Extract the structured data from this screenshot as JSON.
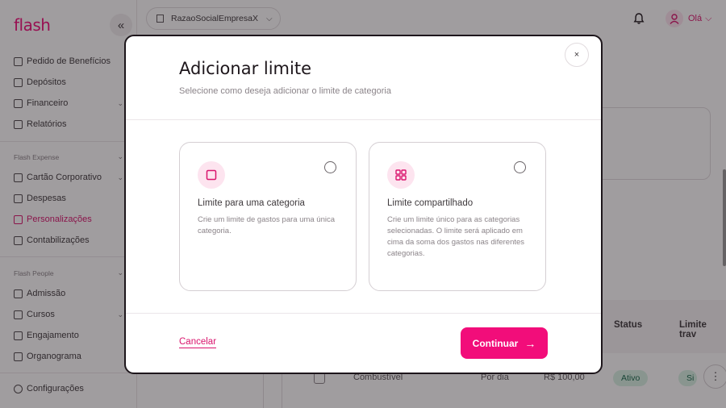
{
  "brand": {
    "logo": "flash",
    "accent": "#f20d7a"
  },
  "sidebar": {
    "collapse_icon": "«",
    "items": [
      {
        "label": "Pedido de Benefícios",
        "icon": "cart-icon"
      },
      {
        "label": "Depósitos",
        "icon": "receipt-icon"
      },
      {
        "label": "Financeiro",
        "icon": "bank-icon"
      },
      {
        "label": "Relatórios",
        "icon": "report-icon"
      }
    ],
    "section_expense": "Flash Expense",
    "expense_items": [
      {
        "label": "Cartão Corporativo",
        "icon": "card-icon"
      },
      {
        "label": "Despesas",
        "icon": "receipt-icon"
      },
      {
        "label": "Personalizações",
        "icon": "sliders-icon"
      },
      {
        "label": "Contabilizações",
        "icon": "calculator-icon"
      }
    ],
    "section_people": "Flash People",
    "people_items": [
      {
        "label": "Admissão",
        "icon": "user-plus-icon"
      },
      {
        "label": "Cursos",
        "icon": "graduation-icon"
      },
      {
        "label": "Engajamento",
        "icon": "megaphone-icon"
      },
      {
        "label": "Organograma",
        "icon": "org-chart-icon"
      }
    ],
    "settings": "Configurações"
  },
  "topbar": {
    "company": "RazaoSocialEmpresaX",
    "greeting": "Olá"
  },
  "table": {
    "headers": {
      "status": "Status",
      "limit_lock": "Limite trav"
    },
    "row": {
      "category": "Combustível",
      "period": "Por dia",
      "amount": "R$ 100,00",
      "status": "Ativo",
      "lock": "Si"
    }
  },
  "modal": {
    "title": "Adicionar limite",
    "subtitle": "Selecione como deseja adicionar o limite de categoria",
    "close_icon": "×",
    "options": [
      {
        "title": "Limite para uma categoria",
        "description": "Crie um limite de gastos para uma única categoria.",
        "icon": "square-icon"
      },
      {
        "title": "Limite compartilhado",
        "description": "Crie um limite único para as categorias selecionadas. O limite será aplicado em cima da soma dos gastos nas diferentes categorias.",
        "icon": "grid-icon"
      }
    ],
    "cancel_label": "Cancelar",
    "continue_label": "Continuar",
    "continue_icon": "→"
  }
}
